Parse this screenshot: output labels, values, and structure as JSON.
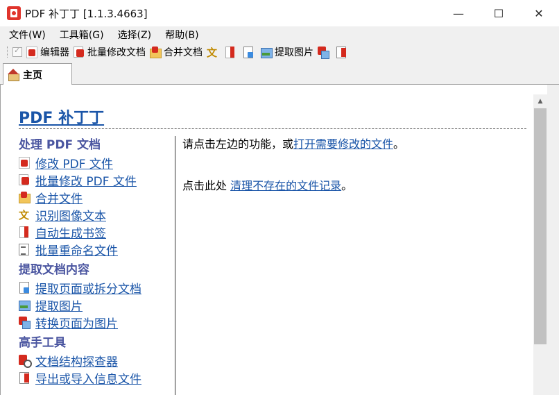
{
  "window": {
    "title": "PDF 补丁丁 [1.1.3.4663]",
    "minimize": "—",
    "maximize": "☐",
    "close": "✕"
  },
  "menu": [
    {
      "label": "文件(W)"
    },
    {
      "label": "工具箱(G)"
    },
    {
      "label": "选择(Z)"
    },
    {
      "label": "帮助(B)"
    }
  ],
  "toolbar": {
    "editor": "编辑器",
    "batch_edit": "批量修改文档",
    "merge": "合并文档",
    "extract_images": "提取图片"
  },
  "tab": {
    "label": "主页"
  },
  "page": {
    "title": "PDF 补丁丁",
    "sections": [
      {
        "title": "处理 PDF 文档",
        "items": [
          {
            "label": "修改 PDF 文件",
            "icon": "pdf-icon"
          },
          {
            "label": "批量修改 PDF 文件",
            "icon": "batch-icon"
          },
          {
            "label": "合并文件",
            "icon": "merge-icon"
          },
          {
            "label": "识别图像文本",
            "icon": "ocr-icon"
          },
          {
            "label": "自动生成书签",
            "icon": "bookmark-icon"
          },
          {
            "label": "批量重命名文件",
            "icon": "rename-icon"
          }
        ]
      },
      {
        "title": "提取文档内容",
        "items": [
          {
            "label": "提取页面或拆分文档",
            "icon": "extract-pages-icon"
          },
          {
            "label": "提取图片",
            "icon": "image-icon"
          },
          {
            "label": "转换页面为图片",
            "icon": "convert-icon"
          }
        ]
      },
      {
        "title": "高手工具",
        "items": [
          {
            "label": "文档结构探查器",
            "icon": "inspect-icon"
          },
          {
            "label": "导出或导入信息文件",
            "icon": "export-icon"
          }
        ]
      }
    ],
    "main": {
      "line1_prefix": "请点击左边的功能，或",
      "line1_link": "打开需要修改的文件",
      "line1_suffix": "。",
      "line2_prefix": "点击此处 ",
      "line2_link": "清理不存在的文件记录",
      "line2_suffix": "。"
    }
  }
}
